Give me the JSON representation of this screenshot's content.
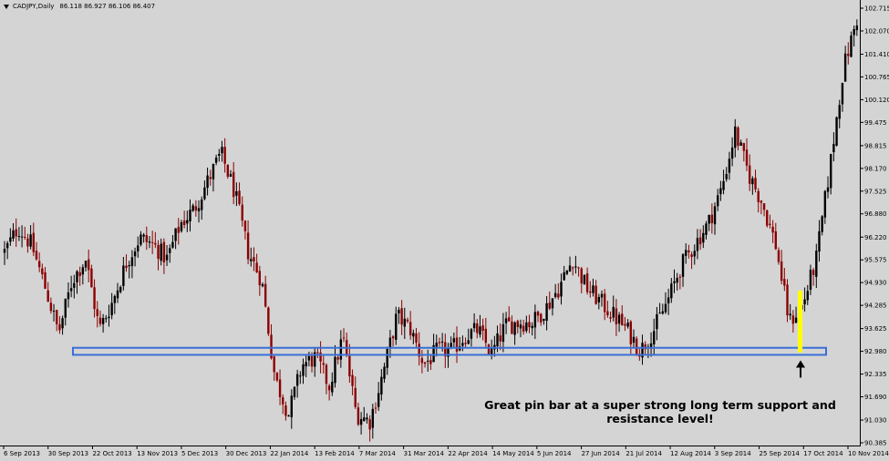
{
  "header": {
    "symbol": "CADJPY,Daily",
    "ohlc": "86.118 86.927 86.106 86.407"
  },
  "annotation": {
    "line1": "Great pin bar at a super strong long term support and",
    "line2": "resistance level!"
  },
  "colors": {
    "background": "#d4d4d4",
    "bull_candle": "#000000",
    "bear_candle": "#8b0000",
    "support_zone": "#3a6fd6",
    "highlight": "#ffff00"
  },
  "chart_data": {
    "type": "candlestick",
    "symbol": "CADJPY",
    "timeframe": "Daily",
    "ylim": [
      90.385,
      102.715
    ],
    "y_ticks": [
      "102.715",
      "102.070",
      "101.410",
      "100.765",
      "100.120",
      "99.475",
      "98.815",
      "98.170",
      "97.525",
      "96.880",
      "96.220",
      "95.575",
      "94.930",
      "94.285",
      "93.625",
      "92.980",
      "92.335",
      "91.690",
      "91.030",
      "90.385"
    ],
    "x_ticks": [
      "6 Sep 2013",
      "30 Sep 2013",
      "22 Oct 2013",
      "13 Nov 2013",
      "5 Dec 2013",
      "30 Dec 2013",
      "22 Jan 2014",
      "13 Feb 2014",
      "7 Mar 2014",
      "31 Mar 2014",
      "22 Apr 2014",
      "14 May 2014",
      "5 Jun 2014",
      "27 Jun 2014",
      "21 Jul 2014",
      "12 Aug 2014",
      "3 Sep 2014",
      "25 Sep 2014",
      "17 Oct 2014",
      "10 Nov 2014"
    ],
    "close_path": [
      {
        "date": "6 Sep 2013",
        "close": 95.8
      },
      {
        "date": "13 Sep 2013",
        "close": 96.5
      },
      {
        "date": "20 Sep 2013",
        "close": 96.0
      },
      {
        "date": "27 Sep 2013",
        "close": 94.8
      },
      {
        "date": "4 Oct 2013",
        "close": 93.5
      },
      {
        "date": "11 Oct 2013",
        "close": 95.0
      },
      {
        "date": "18 Oct 2013",
        "close": 95.6
      },
      {
        "date": "25 Oct 2013",
        "close": 93.6
      },
      {
        "date": "1 Nov 2013",
        "close": 94.4
      },
      {
        "date": "8 Nov 2013",
        "close": 95.5
      },
      {
        "date": "15 Nov 2013",
        "close": 96.2
      },
      {
        "date": "22 Nov 2013",
        "close": 96.0
      },
      {
        "date": "29 Nov 2013",
        "close": 95.6
      },
      {
        "date": "6 Dec 2013",
        "close": 96.6
      },
      {
        "date": "13 Dec 2013",
        "close": 97.0
      },
      {
        "date": "20 Dec 2013",
        "close": 97.8
      },
      {
        "date": "27 Dec 2013",
        "close": 98.6
      },
      {
        "date": "3 Jan 2014",
        "close": 97.5
      },
      {
        "date": "10 Jan 2014",
        "close": 95.8
      },
      {
        "date": "17 Jan 2014",
        "close": 95.0
      },
      {
        "date": "24 Jan 2014",
        "close": 92.2
      },
      {
        "date": "31 Jan 2014",
        "close": 91.2
      },
      {
        "date": "7 Feb 2014",
        "close": 92.6
      },
      {
        "date": "14 Feb 2014",
        "close": 92.8
      },
      {
        "date": "21 Feb 2014",
        "close": 92.0
      },
      {
        "date": "28 Feb 2014",
        "close": 93.4
      },
      {
        "date": "7 Mar 2014",
        "close": 91.2
      },
      {
        "date": "14 Mar 2014",
        "close": 91.0
      },
      {
        "date": "21 Mar 2014",
        "close": 92.4
      },
      {
        "date": "28 Mar 2014",
        "close": 94.0
      },
      {
        "date": "4 Apr 2014",
        "close": 93.6
      },
      {
        "date": "11 Apr 2014",
        "close": 92.6
      },
      {
        "date": "18 Apr 2014",
        "close": 93.0
      },
      {
        "date": "25 Apr 2014",
        "close": 93.0
      },
      {
        "date": "2 May 2014",
        "close": 93.4
      },
      {
        "date": "9 May 2014",
        "close": 93.6
      },
      {
        "date": "16 May 2014",
        "close": 92.9
      },
      {
        "date": "23 May 2014",
        "close": 93.7
      },
      {
        "date": "30 May 2014",
        "close": 93.8
      },
      {
        "date": "6 Jun 2014",
        "close": 93.8
      },
      {
        "date": "13 Jun 2014",
        "close": 94.2
      },
      {
        "date": "20 Jun 2014",
        "close": 94.8
      },
      {
        "date": "27 Jun 2014",
        "close": 95.6
      },
      {
        "date": "4 Jul 2014",
        "close": 94.8
      },
      {
        "date": "11 Jul 2014",
        "close": 94.4
      },
      {
        "date": "18 Jul 2014",
        "close": 94.0
      },
      {
        "date": "25 Jul 2014",
        "close": 93.6
      },
      {
        "date": "1 Aug 2014",
        "close": 93.0
      },
      {
        "date": "8 Aug 2014",
        "close": 93.6
      },
      {
        "date": "15 Aug 2014",
        "close": 94.4
      },
      {
        "date": "22 Aug 2014",
        "close": 95.4
      },
      {
        "date": "29 Aug 2014",
        "close": 96.0
      },
      {
        "date": "5 Sep 2014",
        "close": 96.6
      },
      {
        "date": "12 Sep 2014",
        "close": 97.6
      },
      {
        "date": "19 Sep 2014",
        "close": 99.2
      },
      {
        "date": "26 Sep 2014",
        "close": 98.0
      },
      {
        "date": "3 Oct 2014",
        "close": 97.2
      },
      {
        "date": "10 Oct 2014",
        "close": 96.0
      },
      {
        "date": "14 Oct 2014",
        "close": 93.8
      },
      {
        "date": "17 Oct 2014",
        "close": 94.3
      },
      {
        "date": "24 Oct 2014",
        "close": 95.6
      },
      {
        "date": "31 Oct 2014",
        "close": 98.2
      },
      {
        "date": "7 Nov 2014",
        "close": 101.0
      },
      {
        "date": "10 Nov 2014",
        "close": 102.4
      }
    ],
    "support_zone": {
      "low": 92.88,
      "high": 93.08
    },
    "pin_bar": {
      "date": "14 Oct 2014",
      "high": 94.7,
      "low": 92.95
    },
    "grid": false
  }
}
